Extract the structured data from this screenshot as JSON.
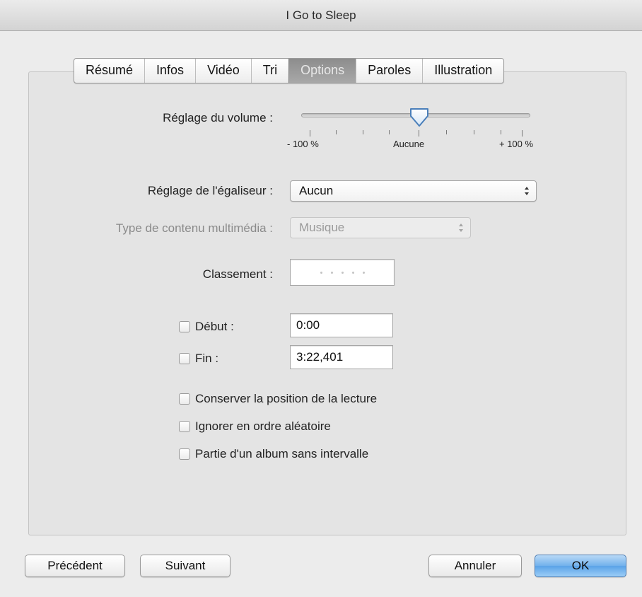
{
  "window": {
    "title": "I Go to Sleep"
  },
  "tabs": [
    {
      "label": "Résumé",
      "active": false
    },
    {
      "label": "Infos",
      "active": false
    },
    {
      "label": "Vidéo",
      "active": false
    },
    {
      "label": "Tri",
      "active": false
    },
    {
      "label": "Options",
      "active": true
    },
    {
      "label": "Paroles",
      "active": false
    },
    {
      "label": "Illustration",
      "active": false
    }
  ],
  "volume": {
    "label": "Réglage du volume :",
    "min_label": "- 100 %",
    "mid_label": "Aucune",
    "max_label": "+ 100 %",
    "value_percent": 0
  },
  "equalizer": {
    "label": "Réglage de l'égaliseur :",
    "value": "Aucun"
  },
  "media_kind": {
    "label": "Type de contenu multimédia :",
    "value": "Musique",
    "disabled": true
  },
  "rating": {
    "label": "Classement :",
    "stars": 0
  },
  "start": {
    "label": "Début :",
    "value": "0:00",
    "checked": false
  },
  "stop": {
    "label": "Fin :",
    "value": "3:22,401",
    "checked": false
  },
  "options": [
    {
      "label": "Conserver la position de la lecture",
      "checked": false
    },
    {
      "label": "Ignorer en ordre aléatoire",
      "checked": false
    },
    {
      "label": "Partie d'un album sans intervalle",
      "checked": false
    }
  ],
  "buttons": {
    "previous": "Précédent",
    "next": "Suivant",
    "cancel": "Annuler",
    "ok": "OK"
  },
  "colors": {
    "active_tab": "#9a9a9a",
    "default_button": "#6eb0ec",
    "window_background": "#ececec"
  }
}
